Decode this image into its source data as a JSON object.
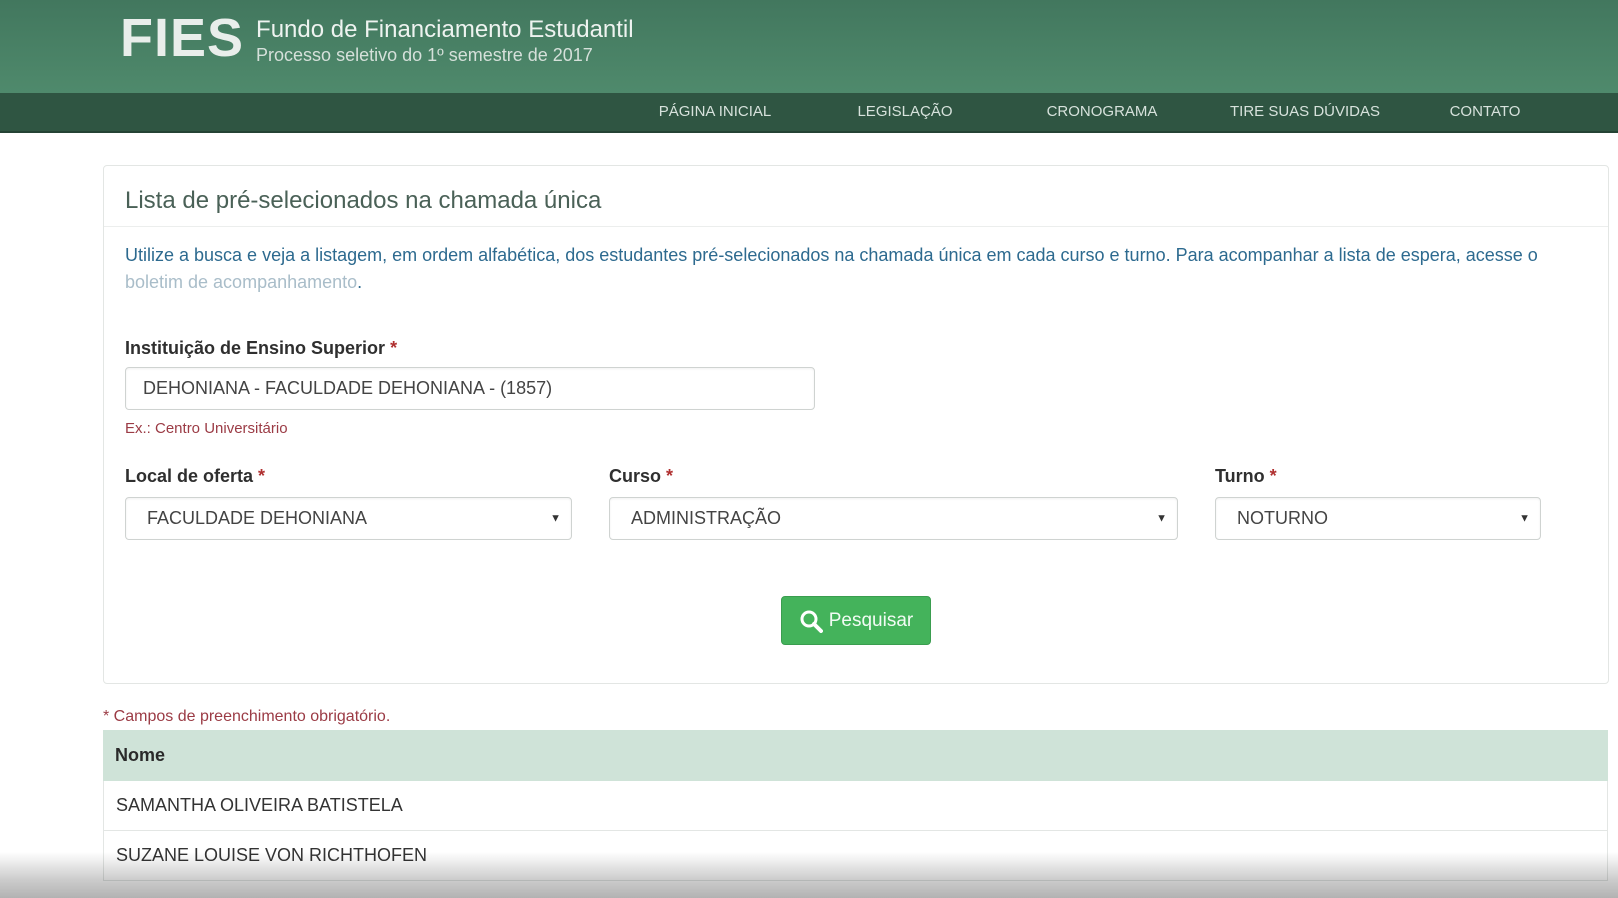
{
  "header": {
    "brand_logo": "FIES",
    "title": "Fundo de Financiamento Estudantil",
    "subtitle": "Processo seletivo do 1º semestre de 2017"
  },
  "nav": {
    "items": [
      "PÁGINA INICIAL",
      "LEGISLAÇÃO",
      "CRONOGRAMA",
      "TIRE SUAS DÚVIDAS",
      "CONTATO"
    ]
  },
  "panel": {
    "title": "Lista de pré-selecionados na chamada única",
    "intro_text": "Utilize a busca e veja a listagem, em ordem alfabética, dos estudantes pré-selecionados na chamada única em cada curso e turno. Para acompanhar a lista de espera, acesse o ",
    "intro_link": "boletim de acompanhamento",
    "intro_end": "."
  },
  "form": {
    "institution": {
      "label": "Instituição de Ensino Superior",
      "required": "*",
      "value": "DEHONIANA - FACULDADE DEHONIANA -  (1857)",
      "hint": "Ex.: Centro Universitário"
    },
    "local": {
      "label": "Local de oferta",
      "required": "*",
      "value": "FACULDADE DEHONIANA"
    },
    "curso": {
      "label": "Curso",
      "required": "*",
      "value": "ADMINISTRAÇÃO"
    },
    "turno": {
      "label": "Turno",
      "required": "*",
      "value": "NOTURNO"
    },
    "search_button": "Pesquisar",
    "search_icon": "search-icon",
    "select_icon": "caret-down-icon"
  },
  "required_note": "* Campos de preenchimento obrigatório.",
  "table": {
    "header": "Nome",
    "rows": [
      "SAMANTHA OLIVEIRA BATISTELA",
      "SUZANE LOUISE VON RICHTHOFEN"
    ]
  },
  "colors": {
    "header_green": "#4f8a6c",
    "nav_green": "#2f5542",
    "button_green": "#44b35b",
    "table_head": "#cfe3d8",
    "required_red": "#b03030"
  }
}
